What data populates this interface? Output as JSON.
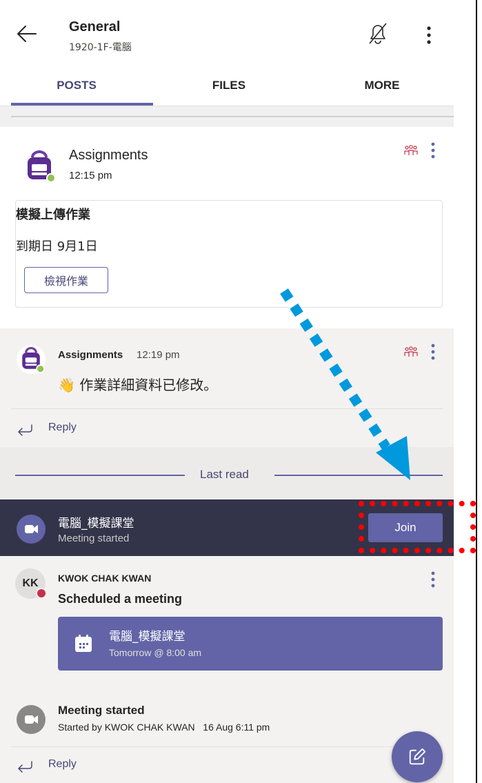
{
  "header": {
    "title": "General",
    "subtitle": "1920-1F-電腦",
    "tabs": [
      {
        "label": "POSTS",
        "active": true
      },
      {
        "label": "FILES",
        "active": false
      },
      {
        "label": "MORE",
        "active": false
      }
    ]
  },
  "posts": {
    "assignment_post": {
      "author": "Assignments",
      "time": "12:15 pm",
      "card": {
        "title": "模擬上傳作業",
        "due": "到期日 9月1日",
        "button": "檢視作業"
      }
    },
    "assignment_reply": {
      "author": "Assignments",
      "time": "12:19 pm",
      "emoji": "👋",
      "message": "作業詳細資料已修改。",
      "reply_label": "Reply"
    },
    "last_read_label": "Last read",
    "meeting_banner": {
      "title": "電腦_模擬課堂",
      "subtitle": "Meeting started",
      "join_label": "Join"
    },
    "scheduled": {
      "avatar_initials": "KK",
      "author": "KWOK CHAK KWAN",
      "message": "Scheduled a meeting",
      "card": {
        "title": "電腦_模擬課堂",
        "time": "Tomorrow @ 8:00 am"
      }
    },
    "meeting_started": {
      "title": "Meeting started",
      "subtitle": "Started by KWOK CHAK KWAN   16 Aug 6:11 pm",
      "reply_label": "Reply"
    }
  },
  "colors": {
    "brand": "#6264a7",
    "banner": "#33344a",
    "annotation_arrow": "#0099dd",
    "annotation_box": "#ff0000"
  },
  "icons": [
    "back-arrow-icon",
    "bell-off-icon",
    "more-vertical-icon",
    "assignments-bag-icon",
    "team-icon",
    "reply-arrow-icon",
    "video-camera-icon",
    "calendar-icon",
    "compose-icon"
  ]
}
